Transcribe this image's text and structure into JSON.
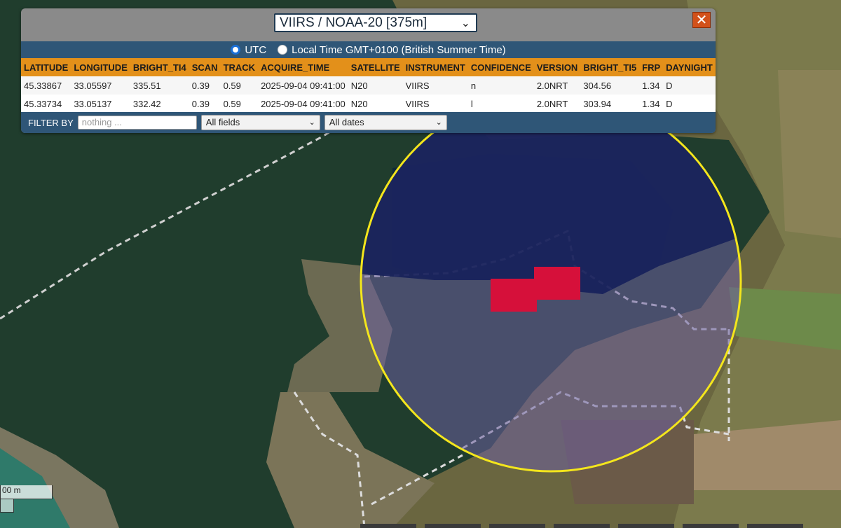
{
  "satellite_select": {
    "value": "VIIRS / NOAA-20 [375m]"
  },
  "close_label": "✕",
  "time": {
    "utc_label": "UTC",
    "local_label": "Local Time GMT+0100 (British Summer Time)"
  },
  "table": {
    "columns": [
      "LATITUDE",
      "LONGITUDE",
      "BRIGHT_TI4",
      "SCAN",
      "TRACK",
      "ACQUIRE_TIME",
      "SATELLITE",
      "INSTRUMENT",
      "CONFIDENCE",
      "VERSION",
      "BRIGHT_TI5",
      "FRP",
      "DAYNIGHT"
    ],
    "rows": [
      [
        "45.33867",
        "33.05597",
        "335.51",
        "0.39",
        "0.59",
        "2025-09-04 09:41:00",
        "N20",
        "VIIRS",
        "n",
        "2.0NRT",
        "304.56",
        "1.34",
        "D"
      ],
      [
        "45.33734",
        "33.05137",
        "332.42",
        "0.39",
        "0.59",
        "2025-09-04 09:41:00",
        "N20",
        "VIIRS",
        "l",
        "2.0NRT",
        "303.94",
        "1.34",
        "D"
      ]
    ]
  },
  "filter": {
    "label": "FILTER BY",
    "placeholder": "nothing ...",
    "fields_value": "All fields",
    "dates_value": "All dates"
  },
  "scale_label": "00 m",
  "colors": {
    "header_orange": "#e3901a",
    "bar_blue": "#2f5677",
    "circle": "#f4e61c",
    "hotspot": "#d6103a",
    "close": "#d2511a"
  }
}
